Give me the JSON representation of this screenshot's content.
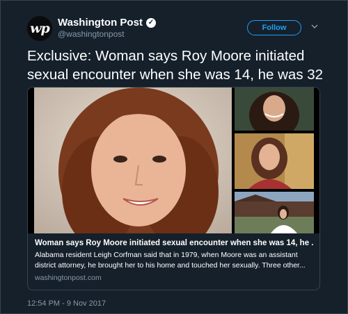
{
  "account": {
    "avatar_text": "wp",
    "display_name": "Washington Post",
    "verified_icon": "verified-badge-icon",
    "handle": "@washingtonpost"
  },
  "actions": {
    "follow_label": "Follow",
    "menu_icon": "chevron-down-icon"
  },
  "tweet": {
    "text": "Exclusive: Woman says Roy Moore initiated sexual encounter when she was 14, he was 32",
    "timestamp": "12:54 PM - 9 Nov 2017"
  },
  "card": {
    "title": "Woman says Roy Moore initiated sexual encounter when she was 14, he ...",
    "description": "Alabama resident Leigh Corfman said that in 1979, when Moore was an assistant district attorney, he brought her to his home and touched her sexually. Three other...",
    "domain": "washingtonpost.com"
  },
  "colors": {
    "background": "#15202b",
    "accent": "#1da1f2",
    "secondary_text": "#8899a6",
    "border": "#38444d"
  }
}
